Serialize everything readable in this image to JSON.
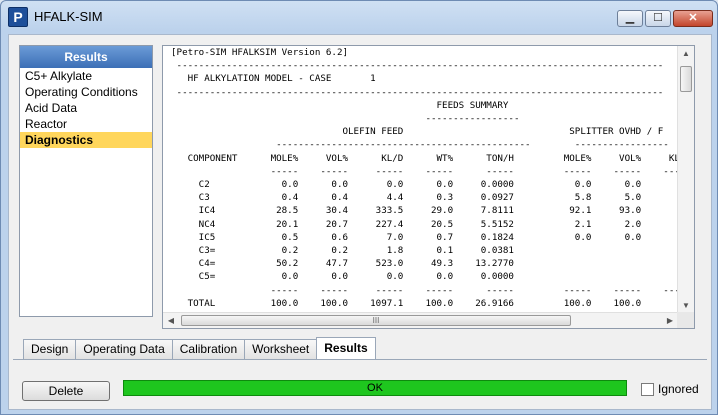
{
  "window": {
    "title": "HFALK-SIM",
    "app_icon_letter": "P",
    "buttons": {
      "minimize": "▁",
      "maximize": "☐",
      "close": "✕"
    }
  },
  "sidebar": {
    "header": "Results",
    "items": [
      {
        "label": "C5+ Alkylate"
      },
      {
        "label": "Operating Conditions"
      },
      {
        "label": "Acid Data"
      },
      {
        "label": "Reactor"
      },
      {
        "label": "Diagnostics",
        "selected": true
      }
    ]
  },
  "report": {
    "text": "[Petro-SIM HFALKSIM Version 6.2]\n ----------------------------------------------------------------------------------------\n   HF ALKYLATION MODEL - CASE       1\n ----------------------------------------------------------------------------------------\n                                                FEEDS SUMMARY\n                                              -----------------\n                               OLEFIN FEED                              SPLITTER OVHD / F\n                   ----------------------------------------------        -----------------\n   COMPONENT      MOLE%     VOL%      KL/D      WT%      TON/H         MOLE%     VOL%     KL/D\n                  -----    -----     -----    -----      -----         -----    -----    -----\n     C2             0.0      0.0       0.0      0.0     0.0000           0.0      0.0       0.\n     C3             0.4      0.4       4.4      0.3     0.0927           5.8      5.0       0.\n     IC4           28.5     30.4     333.5     29.0     7.8111          92.1     93.0       0.\n     NC4           20.1     20.7     227.4     20.5     5.5152           2.1      2.0       0.\n     IC5            0.5      0.6       7.0      0.7     0.1824           0.0      0.0       0.\n     C3=            0.2      0.2       1.8      0.1     0.0381\n     C4=           50.2     47.7     523.0     49.3    13.2770\n     C5=            0.0      0.0       0.0      0.0     0.0000\n                  -----    -----     -----    -----      -----         -----    -----    -----\n   TOTAL          100.0    100.0    1097.1    100.0    26.9166         100.0    100.0\n                                     TOTAL RECYCLE"
  },
  "scrollbars": {
    "up": "▲",
    "down": "▼",
    "left": "◀",
    "right": "▶",
    "grip": "III"
  },
  "tabs": [
    {
      "label": "Design"
    },
    {
      "label": "Operating Data"
    },
    {
      "label": "Calibration"
    },
    {
      "label": "Worksheet"
    },
    {
      "label": "Results",
      "active": true
    }
  ],
  "footer": {
    "delete_label": "Delete",
    "status_text": "OK",
    "status_color": "#1ec61e",
    "ignored_label": "Ignored",
    "ignored_checked": false
  }
}
